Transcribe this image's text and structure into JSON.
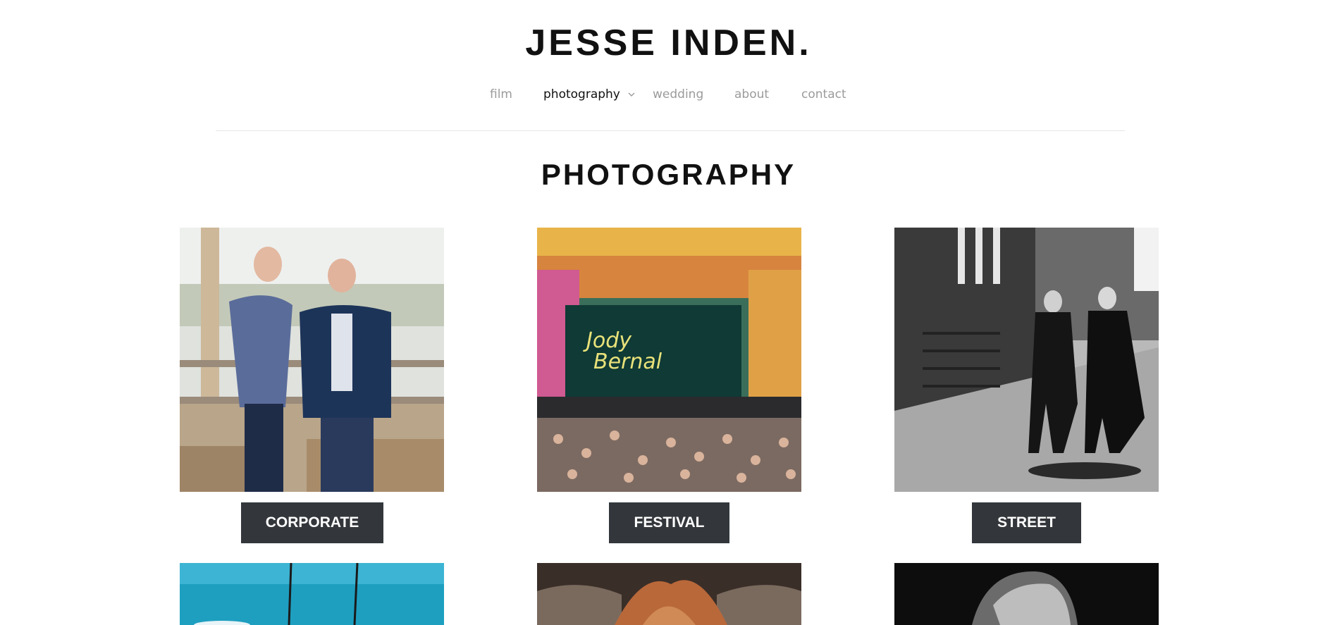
{
  "site": {
    "title": "JESSE INDEN."
  },
  "nav": {
    "items": [
      {
        "label": "film"
      },
      {
        "label": "photography",
        "active": true
      },
      {
        "label": "wedding"
      },
      {
        "label": "about"
      },
      {
        "label": "contact"
      }
    ],
    "dropdown_icon": "chevron-down-icon"
  },
  "page": {
    "title": "PHOTOGRAPHY"
  },
  "galleries": [
    {
      "label": "CORPORATE",
      "image": "corporate-photo"
    },
    {
      "label": "FESTIVAL",
      "image": "festival-photo"
    },
    {
      "label": "STREET",
      "image": "street-photo"
    }
  ],
  "galleries_row2": [
    {
      "image": "sky-photo"
    },
    {
      "image": "highland-cow-photo"
    },
    {
      "image": "portrait-photo"
    }
  ],
  "colors": {
    "accent_button": "#33373b",
    "nav_inactive": "#9b9b9b",
    "text": "#111111"
  }
}
